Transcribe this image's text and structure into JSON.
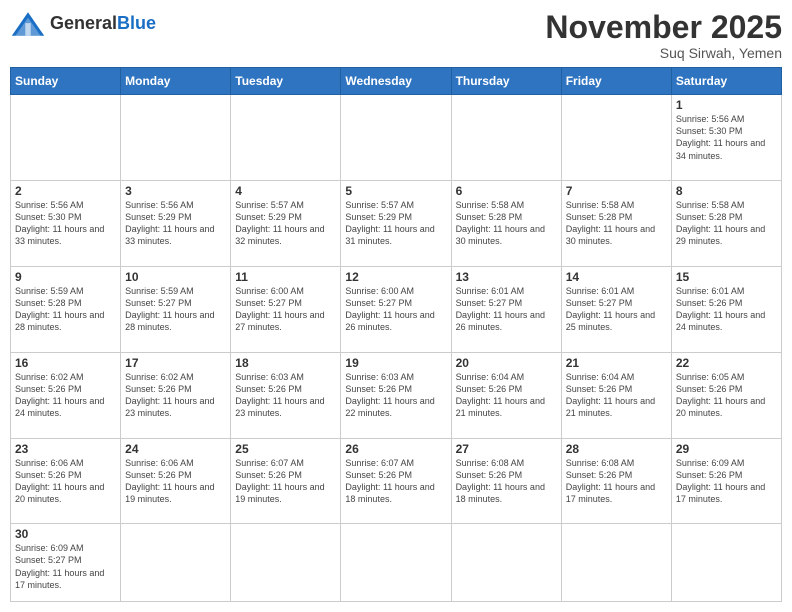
{
  "logo": {
    "general": "General",
    "blue": "Blue"
  },
  "header": {
    "month": "November 2025",
    "location": "Suq Sirwah, Yemen"
  },
  "weekdays": [
    "Sunday",
    "Monday",
    "Tuesday",
    "Wednesday",
    "Thursday",
    "Friday",
    "Saturday"
  ],
  "weeks": [
    [
      {
        "day": "",
        "info": ""
      },
      {
        "day": "",
        "info": ""
      },
      {
        "day": "",
        "info": ""
      },
      {
        "day": "",
        "info": ""
      },
      {
        "day": "",
        "info": ""
      },
      {
        "day": "",
        "info": ""
      },
      {
        "day": "1",
        "info": "Sunrise: 5:56 AM\nSunset: 5:30 PM\nDaylight: 11 hours\nand 34 minutes."
      }
    ],
    [
      {
        "day": "2",
        "info": "Sunrise: 5:56 AM\nSunset: 5:30 PM\nDaylight: 11 hours\nand 33 minutes."
      },
      {
        "day": "3",
        "info": "Sunrise: 5:56 AM\nSunset: 5:29 PM\nDaylight: 11 hours\nand 33 minutes."
      },
      {
        "day": "4",
        "info": "Sunrise: 5:57 AM\nSunset: 5:29 PM\nDaylight: 11 hours\nand 32 minutes."
      },
      {
        "day": "5",
        "info": "Sunrise: 5:57 AM\nSunset: 5:29 PM\nDaylight: 11 hours\nand 31 minutes."
      },
      {
        "day": "6",
        "info": "Sunrise: 5:58 AM\nSunset: 5:28 PM\nDaylight: 11 hours\nand 30 minutes."
      },
      {
        "day": "7",
        "info": "Sunrise: 5:58 AM\nSunset: 5:28 PM\nDaylight: 11 hours\nand 30 minutes."
      },
      {
        "day": "8",
        "info": "Sunrise: 5:58 AM\nSunset: 5:28 PM\nDaylight: 11 hours\nand 29 minutes."
      }
    ],
    [
      {
        "day": "9",
        "info": "Sunrise: 5:59 AM\nSunset: 5:28 PM\nDaylight: 11 hours\nand 28 minutes."
      },
      {
        "day": "10",
        "info": "Sunrise: 5:59 AM\nSunset: 5:27 PM\nDaylight: 11 hours\nand 28 minutes."
      },
      {
        "day": "11",
        "info": "Sunrise: 6:00 AM\nSunset: 5:27 PM\nDaylight: 11 hours\nand 27 minutes."
      },
      {
        "day": "12",
        "info": "Sunrise: 6:00 AM\nSunset: 5:27 PM\nDaylight: 11 hours\nand 26 minutes."
      },
      {
        "day": "13",
        "info": "Sunrise: 6:01 AM\nSunset: 5:27 PM\nDaylight: 11 hours\nand 26 minutes."
      },
      {
        "day": "14",
        "info": "Sunrise: 6:01 AM\nSunset: 5:27 PM\nDaylight: 11 hours\nand 25 minutes."
      },
      {
        "day": "15",
        "info": "Sunrise: 6:01 AM\nSunset: 5:26 PM\nDaylight: 11 hours\nand 24 minutes."
      }
    ],
    [
      {
        "day": "16",
        "info": "Sunrise: 6:02 AM\nSunset: 5:26 PM\nDaylight: 11 hours\nand 24 minutes."
      },
      {
        "day": "17",
        "info": "Sunrise: 6:02 AM\nSunset: 5:26 PM\nDaylight: 11 hours\nand 23 minutes."
      },
      {
        "day": "18",
        "info": "Sunrise: 6:03 AM\nSunset: 5:26 PM\nDaylight: 11 hours\nand 23 minutes."
      },
      {
        "day": "19",
        "info": "Sunrise: 6:03 AM\nSunset: 5:26 PM\nDaylight: 11 hours\nand 22 minutes."
      },
      {
        "day": "20",
        "info": "Sunrise: 6:04 AM\nSunset: 5:26 PM\nDaylight: 11 hours\nand 21 minutes."
      },
      {
        "day": "21",
        "info": "Sunrise: 6:04 AM\nSunset: 5:26 PM\nDaylight: 11 hours\nand 21 minutes."
      },
      {
        "day": "22",
        "info": "Sunrise: 6:05 AM\nSunset: 5:26 PM\nDaylight: 11 hours\nand 20 minutes."
      }
    ],
    [
      {
        "day": "23",
        "info": "Sunrise: 6:06 AM\nSunset: 5:26 PM\nDaylight: 11 hours\nand 20 minutes."
      },
      {
        "day": "24",
        "info": "Sunrise: 6:06 AM\nSunset: 5:26 PM\nDaylight: 11 hours\nand 19 minutes."
      },
      {
        "day": "25",
        "info": "Sunrise: 6:07 AM\nSunset: 5:26 PM\nDaylight: 11 hours\nand 19 minutes."
      },
      {
        "day": "26",
        "info": "Sunrise: 6:07 AM\nSunset: 5:26 PM\nDaylight: 11 hours\nand 18 minutes."
      },
      {
        "day": "27",
        "info": "Sunrise: 6:08 AM\nSunset: 5:26 PM\nDaylight: 11 hours\nand 18 minutes."
      },
      {
        "day": "28",
        "info": "Sunrise: 6:08 AM\nSunset: 5:26 PM\nDaylight: 11 hours\nand 17 minutes."
      },
      {
        "day": "29",
        "info": "Sunrise: 6:09 AM\nSunset: 5:26 PM\nDaylight: 11 hours\nand 17 minutes."
      }
    ],
    [
      {
        "day": "30",
        "info": "Sunrise: 6:09 AM\nSunset: 5:27 PM\nDaylight: 11 hours\nand 17 minutes."
      },
      {
        "day": "",
        "info": ""
      },
      {
        "day": "",
        "info": ""
      },
      {
        "day": "",
        "info": ""
      },
      {
        "day": "",
        "info": ""
      },
      {
        "day": "",
        "info": ""
      },
      {
        "day": "",
        "info": ""
      }
    ]
  ]
}
